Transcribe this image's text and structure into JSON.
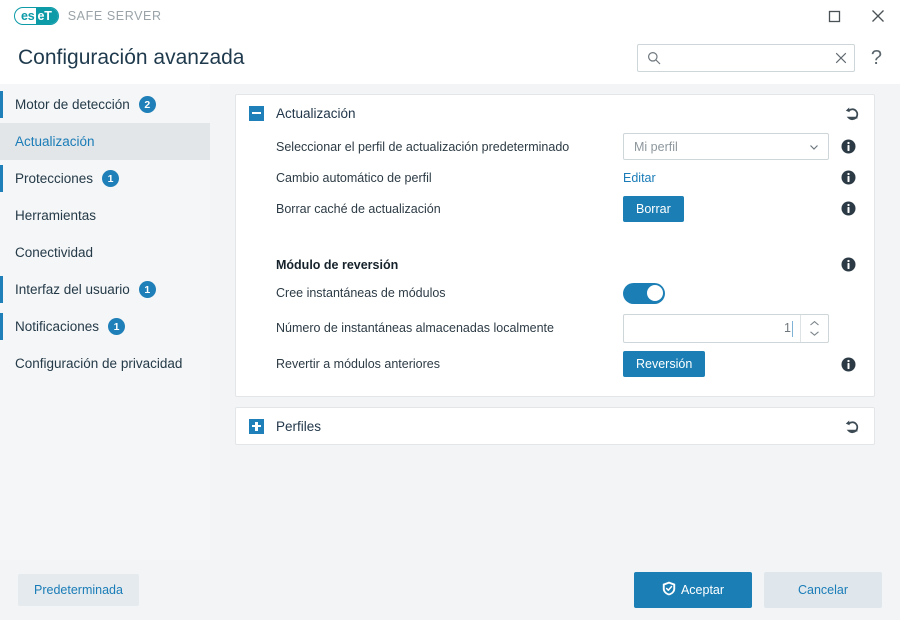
{
  "window": {
    "brand": "eset",
    "brand_part1": "es",
    "brand_part2": "eT",
    "product": "SAFE SERVER",
    "maximize_label": "Maximizar",
    "close_label": "Cerrar"
  },
  "header": {
    "title": "Configuración avanzada",
    "search": {
      "value": "",
      "placeholder": "",
      "clear_label": "✕"
    },
    "help_label": "?"
  },
  "sidebar": {
    "items": [
      {
        "label": "Motor de detección",
        "badge": "2",
        "selected": false,
        "marker": true
      },
      {
        "label": "Actualización",
        "badge": "",
        "selected": true,
        "marker": false
      },
      {
        "label": "Protecciones",
        "badge": "1",
        "selected": false,
        "marker": true
      },
      {
        "label": "Herramientas",
        "badge": "",
        "selected": false,
        "marker": false
      },
      {
        "label": "Conectividad",
        "badge": "",
        "selected": false,
        "marker": false
      },
      {
        "label": "Interfaz del usuario",
        "badge": "1",
        "selected": false,
        "marker": true
      },
      {
        "label": "Notificaciones",
        "badge": "1",
        "selected": false,
        "marker": true
      },
      {
        "label": "Configuración de privacidad",
        "badge": "",
        "selected": false,
        "marker": false
      }
    ]
  },
  "main": {
    "sections": [
      {
        "title": "Actualización",
        "expanded": true,
        "expander_icon": "minus-icon",
        "reset_icon": "undo-icon"
      },
      {
        "title": "Perfiles",
        "expanded": false,
        "expander_icon": "plus-icon",
        "reset_icon": "undo-icon"
      }
    ],
    "update_section": {
      "row_profile_label": "Seleccionar el perfil de actualización predeterminado",
      "profile_select_value": "Mi perfil",
      "row_autoswitch_label": "Cambio automático de perfil",
      "autoswitch_link": "Editar",
      "row_cache_label": "Borrar caché de actualización",
      "cache_button": "Borrar",
      "rollback_group_label": "Módulo de reversión",
      "row_snapshots_label": "Cree instantáneas de módulos",
      "snapshots_toggle_on": true,
      "row_count_label": "Número de instantáneas almacenadas localmente",
      "count_value": "1",
      "row_rollback_label": "Revertir a módulos anteriores",
      "rollback_button": "Reversión"
    }
  },
  "footer": {
    "default_button": "Predeterminada",
    "accept_button": "Aceptar",
    "cancel_button": "Cancelar"
  },
  "colors": {
    "accent_blue": "#1b7fb5",
    "brand_teal": "#0d9ba8",
    "link_blue": "#1a7cb8",
    "page_bg": "#f2f4f5"
  }
}
